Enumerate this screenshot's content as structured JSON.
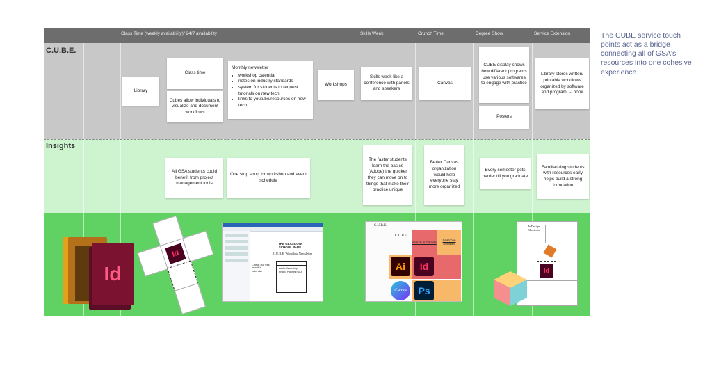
{
  "header": {
    "columns": [
      "Class Time (weekly availability)/ 24/7 availability",
      "Skills Week",
      "Crunch Time",
      "Degree Show",
      "Service Extension"
    ]
  },
  "rows": {
    "cube_label": "C.U.B.E.",
    "insights_label": "Insights"
  },
  "cube_cards": {
    "library": "Library",
    "class_time": "Class time",
    "cubes_allow": "Cubes allow individuals to visualize and document workflows",
    "newsletter_title": "Monthly newsletter",
    "newsletter_items": [
      "workshop calendar",
      "notes on industry standards",
      "system for students to request tutorials on new tech",
      "links to youtube/resources on new tech"
    ],
    "workshops": "Workshops",
    "skills_week": "Skills week like a conference with panels and speakers",
    "canvas": "Canvas",
    "cube_display": "CUBE display shows how different programs use various softwares to engage with practice",
    "posters": "Posters",
    "library_stores": "Library stores written/ printable workflows organized by software and program → book"
  },
  "insight_cards": {
    "gsa_students": "All GSA students could benefit from project management tools",
    "one_stop": "One stop shop for workshop and event schedule",
    "faster_students": "The faster students learn the basics (Adobe) the quicker they can move on to things that make their practice unique",
    "better_canvas": "Better Canvas organization would help everyone stay more organized",
    "every_semester": "Every semester gets harder till you graduate",
    "familiarizing": "Familiarizing students with resources early helps build a strong foundation"
  },
  "side_note": "The CUBE service touch points act as a bridge connecting all of GSA's resources into one cohesive experience",
  "images": {
    "id_letters": "Id",
    "ai_letters": "Ai",
    "ps_letters": "Ps",
    "canva_letters": "Canva",
    "newsletter_school": "THE GLASGOW SCHOOL PARE",
    "newsletter_heading": "C.U.B.E. Workflow Newsletter",
    "newsletter_checkout": "Check our this month's calendar",
    "newsletter_bullets": [
      "Adobe Workshop",
      "Project Planning Q&A"
    ],
    "canvas_title": "C.U.B.E.",
    "canvas_sub": "C.U.B.E.",
    "canvas_link1": "Search in Canvas",
    "canvas_link2": "Search in Software",
    "indesign_title": "InDesign Shortcuts"
  },
  "colors": {
    "header": "#6d6d6d",
    "cube_row": "#c8c8c8",
    "insights_row": "#cdf3cf",
    "image_row": "#5fd263",
    "indesign": "#49021f",
    "indesign_text": "#ff3366",
    "illustrator": "#330000",
    "illustrator_text": "#ff9a00",
    "photoshop": "#001e36",
    "photoshop_text": "#31a8ff",
    "note_text": "#5a6690"
  }
}
